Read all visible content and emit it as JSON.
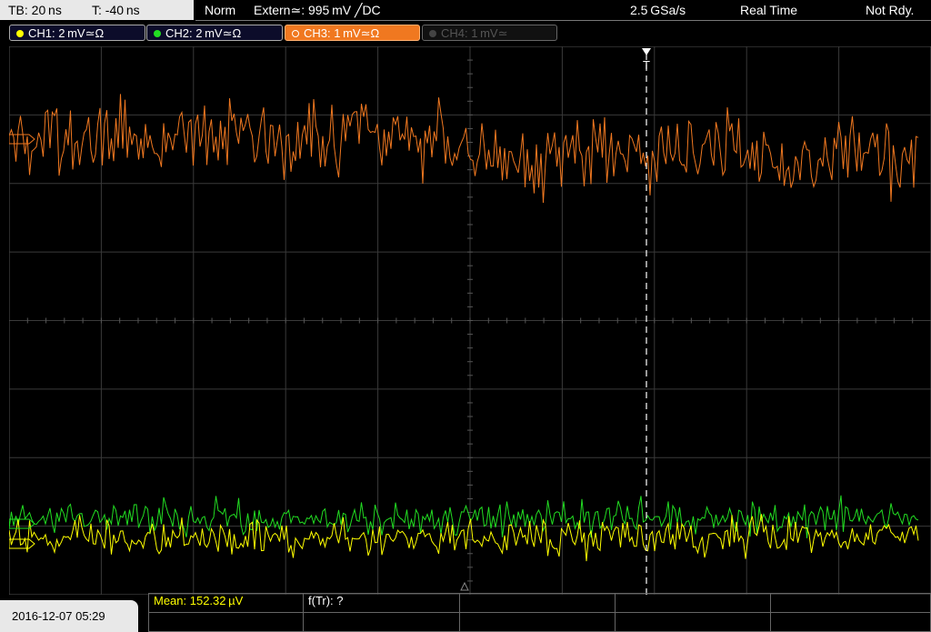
{
  "timebase": {
    "tb": "TB: 20 ns",
    "trig_offset": "T: -40 ns"
  },
  "status": {
    "mode": "Norm",
    "trigger": "Extern≃: 995 mV ╱DC",
    "sample_rate": "2.5 GSa/s",
    "acq": "Real Time",
    "ready": "Not Rdy."
  },
  "channels": [
    {
      "label": "CH1: 2 mV≃Ω",
      "color": "#ffff00"
    },
    {
      "label": "CH2: 2 mV≃Ω",
      "color": "#22dd22"
    },
    {
      "label": "CH3: 1 mV≃Ω",
      "color": "#f07820"
    },
    {
      "label": "CH4: 1 mV≃",
      "color": "#444444"
    }
  ],
  "trigger_marker": "T",
  "datetime": "2016-12-07 05:29",
  "measurements": {
    "mean": "Mean: 152.32 µV",
    "freq": "f(Tr): ?"
  },
  "colors": {
    "grid": "#3a3a3a",
    "ch1": "#ffff00",
    "ch2": "#22dd22",
    "ch3": "#f07820",
    "trigger_line": "#ffffff"
  }
}
